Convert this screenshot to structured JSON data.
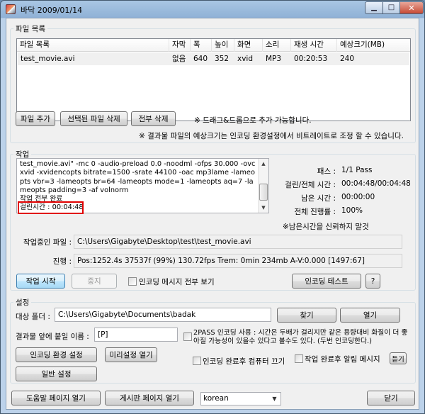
{
  "window": {
    "title": "바닥 2009/01/14"
  },
  "file_list": {
    "group_title": "파일 목록",
    "columns": [
      "파일 목록",
      "자막",
      "폭",
      "높이",
      "화면",
      "소리",
      "재생 시간",
      "예상크기(MB)"
    ],
    "rows": [
      {
        "name": "test_movie.avi",
        "subtitle": "없음",
        "width": "640",
        "height": "352",
        "video": "xvid",
        "audio": "MP3",
        "duration": "00:20:53",
        "size": "240"
      }
    ],
    "add_button": "파일 추가",
    "remove_selected_button": "선택된 파일 삭제",
    "remove_all_button": "전부 삭제",
    "drag_note": "※ 드래그&드롭으로 추가 가능합니다.",
    "size_note": "※ 결과물 파일의 예상크기는 인코딩 환경설정에서 비트레이트로 조정 할 수 있습니다."
  },
  "job": {
    "group_title": "작업",
    "log": "test_movie.avi\" -mc 0 -audio-preload 0.0 -noodml -ofps 30.000 -ovc xvid -xvidencopts bitrate=1500 -srate 44100 -oac mp3lame -lameopts vbr=3 -lameopts br=64 -lameopts mode=1 -lameopts aq=7 -lameopts padding=3 -af volnorm\n작업 전부 완료\n걸린시간 : 00:04:48",
    "pass_label": "패스 :",
    "pass_value": "1/1 Pass",
    "elapsed_label": "걸린/전체 시간 :",
    "elapsed_value": "00:04:48/00:04:48",
    "remaining_label": "남은 시간 :",
    "remaining_value": "00:00:00",
    "progress_label": "전체 진행률 :",
    "progress_value": "100%",
    "remaining_note": "※남은시간을 신뢰하지 말것",
    "current_file_label": "작업중인 파일 :",
    "current_file_value": "C:\\Users\\Gigabyte\\Desktop\\test\\test_movie.avi",
    "status_label": "진행 :",
    "status_value": "Pos:1252.4s  37537f (99%) 130.72fps Trem:    0min 234mb  A-V:0.000 [1497:67]",
    "start_button": "작업 시작",
    "stop_button": "중지",
    "show_all_messages": "인코딩 메시지 전부 보기",
    "encoding_test_button": "인코딩 테스트",
    "help_button": "?"
  },
  "settings": {
    "group_title": "설정",
    "target_folder_label": "대상 폴더 :",
    "target_folder_value": "C:\\Users\\Gigabyte\\Documents\\badak",
    "browse_button": "찾기",
    "open_button": "열기",
    "prefix_label": "결과물 앞에 붙일 이름 :",
    "prefix_value": "[P]",
    "two_pass_text": "2PASS 인코딩 사용 : 시간은 두배가 걸리지만 같은 용량대비 화질이 더 좋아질 가능성이 있을수 있다고 볼수도 있다. (두번 인코딩한다.)",
    "encoding_settings_button": "인코딩 환경 설정",
    "preset_button": "미리설정 열기",
    "shutdown_after": "인코딩 완료후 컴퓨터 끄기",
    "alert_after": "작업 완료후 알림 메시지",
    "listen_button": "듣기",
    "general_settings_button": "일반 설정"
  },
  "footer": {
    "help_page_button": "도움말 페이지 열기",
    "board_page_button": "게시판 페이지 열기",
    "language_value": "korean",
    "close_button": "닫기"
  },
  "icons": {
    "min": "minimize-icon",
    "max": "maximize-icon",
    "close": "close-icon"
  }
}
